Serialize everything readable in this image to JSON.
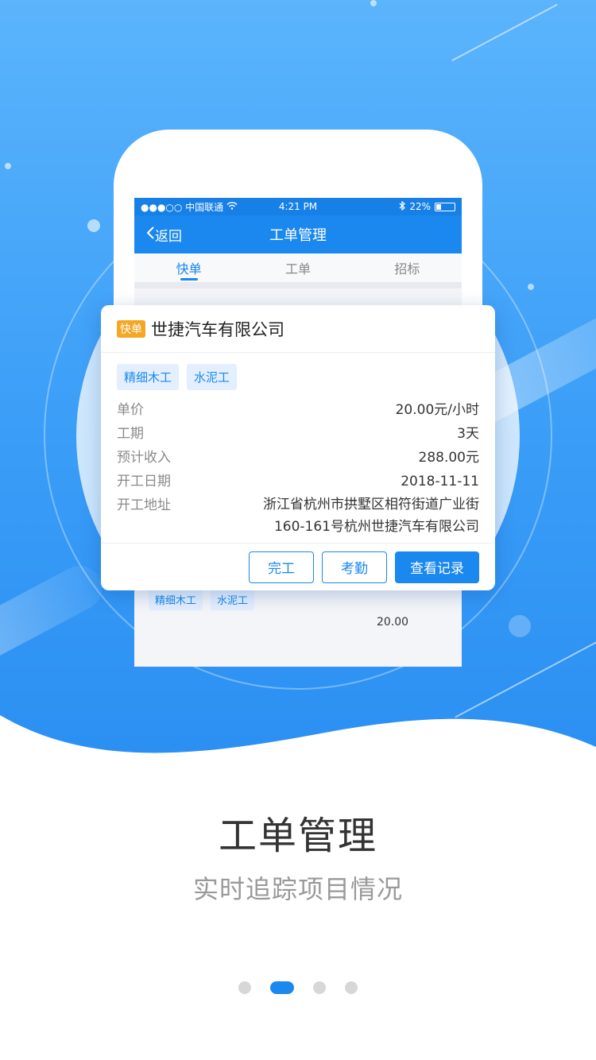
{
  "statusbar": {
    "carrier": "●●●○○ 中国联通",
    "time": "4:21 PM",
    "battery": "22%"
  },
  "navbar": {
    "back_label": "返回",
    "title": "工单管理"
  },
  "tabs": [
    {
      "label": "快单",
      "active": true
    },
    {
      "label": "工单",
      "active": false
    },
    {
      "label": "招标",
      "active": false
    }
  ],
  "background_list": {
    "tags": [
      "精细木工",
      "水泥工"
    ],
    "price_preview": "20.00"
  },
  "card": {
    "badge": "快单",
    "company": "世捷汽车有限公司",
    "tags": [
      "精细木工",
      "水泥工"
    ],
    "fields": [
      {
        "key": "单价",
        "value": "20.00元/小时"
      },
      {
        "key": "工期",
        "value": "3天"
      },
      {
        "key": "预计收入",
        "value": "288.00元"
      },
      {
        "key": "开工日期",
        "value": "2018-11-11"
      },
      {
        "key": "开工地址",
        "value": "浙江省杭州市拱墅区相符街道广业街160-161号杭州世捷汽车有限公司"
      }
    ],
    "buttons": {
      "complete": "完工",
      "attendance": "考勤",
      "records": "查看记录"
    }
  },
  "headline": "工单管理",
  "subline": "实时追踪项目情况",
  "pager": {
    "total": 4,
    "active_index": 1
  },
  "colors": {
    "primary": "#1a88ee",
    "badge": "#f5a623",
    "background_top": "#5bb4fc",
    "background_bottom": "#2a8ef2"
  }
}
